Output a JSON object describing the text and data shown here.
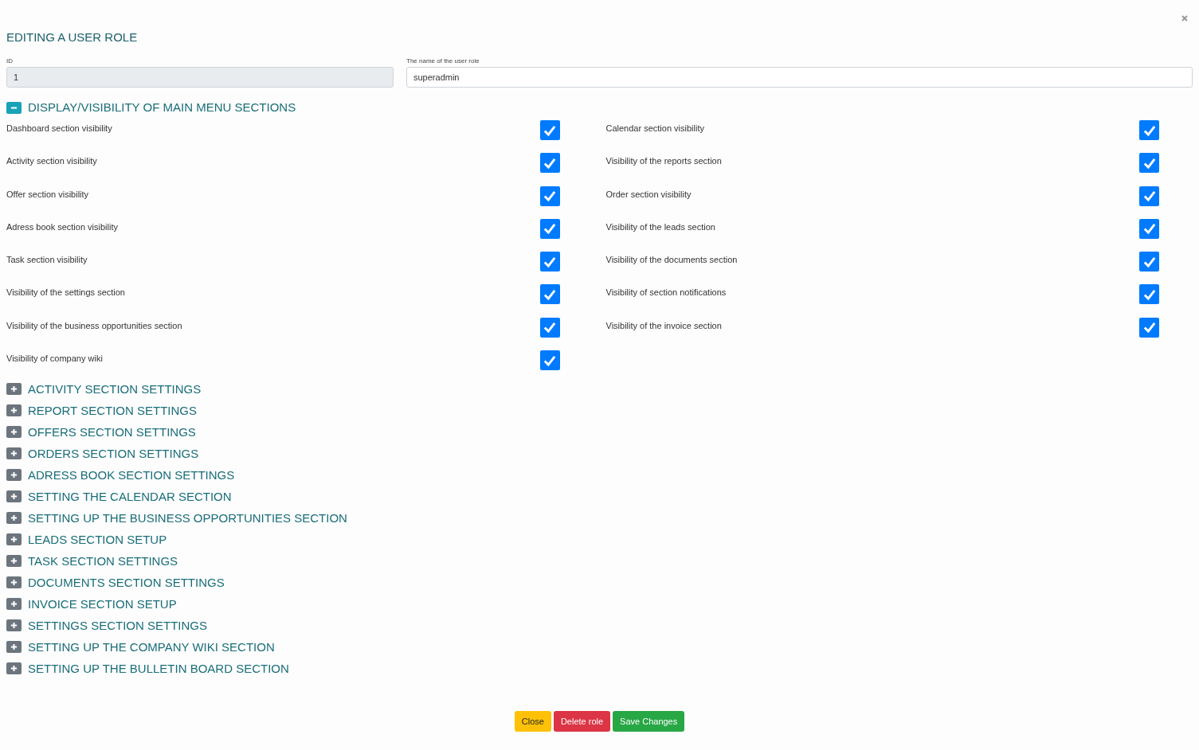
{
  "title": "EDITING A USER ROLE",
  "fields": [
    {
      "label": "ID",
      "value": "1",
      "disabled": true
    },
    {
      "label": "The name of the user role",
      "value": "superadmin",
      "disabled": false
    }
  ],
  "sections": [
    {
      "title": "DISPLAY/VISIBILITY OF MAIN MENU SECTIONS",
      "expanded": true,
      "items": [
        {
          "label": "Dashboard section visibility",
          "checked": true
        },
        {
          "label": "Calendar section visibility",
          "checked": true
        },
        {
          "label": "Activity section visibility",
          "checked": true
        },
        {
          "label": "Visibility of the reports section",
          "checked": true
        },
        {
          "label": "Offer section visibility",
          "checked": true
        },
        {
          "label": "Order section visibility",
          "checked": true
        },
        {
          "label": "Adress book section visibility",
          "checked": true
        },
        {
          "label": "Visibility of the leads section",
          "checked": true
        },
        {
          "label": "Task section visibility",
          "checked": true
        },
        {
          "label": "Visibility of the documents section",
          "checked": true
        },
        {
          "label": "Visibility of the settings section",
          "checked": true
        },
        {
          "label": "Visibility of section notifications",
          "checked": true
        },
        {
          "label": "Visibility of the business opportunities section",
          "checked": true
        },
        {
          "label": "Visibility of the invoice section",
          "checked": true
        },
        {
          "label": "Visibility of company wiki",
          "checked": true
        }
      ]
    },
    {
      "title": "ACTIVITY SECTION SETTINGS",
      "expanded": false
    },
    {
      "title": "REPORT SECTION SETTINGS",
      "expanded": false
    },
    {
      "title": "OFFERS SECTION SETTINGS",
      "expanded": false
    },
    {
      "title": "ORDERS SECTION SETTINGS",
      "expanded": false
    },
    {
      "title": "ADRESS BOOK SECTION SETTINGS",
      "expanded": false
    },
    {
      "title": "SETTING THE CALENDAR SECTION",
      "expanded": false
    },
    {
      "title": "SETTING UP THE BUSINESS OPPORTUNITIES SECTION",
      "expanded": false
    },
    {
      "title": "LEADS SECTION SETUP",
      "expanded": false
    },
    {
      "title": "TASK SECTION SETTINGS",
      "expanded": false
    },
    {
      "title": "DOCUMENTS SECTION SETTINGS",
      "expanded": false
    },
    {
      "title": "INVOICE SECTION SETUP",
      "expanded": false
    },
    {
      "title": "SETTINGS SECTION SETTINGS",
      "expanded": false
    },
    {
      "title": "SETTING UP THE COMPANY WIKI SECTION",
      "expanded": false
    },
    {
      "title": "SETTING UP THE BULLETIN BOARD SECTION",
      "expanded": false
    }
  ],
  "buttons": [
    {
      "label": "Close",
      "kind": "warning"
    },
    {
      "label": "Delete role",
      "kind": "danger"
    },
    {
      "label": "Save Changes",
      "kind": "success"
    }
  ]
}
